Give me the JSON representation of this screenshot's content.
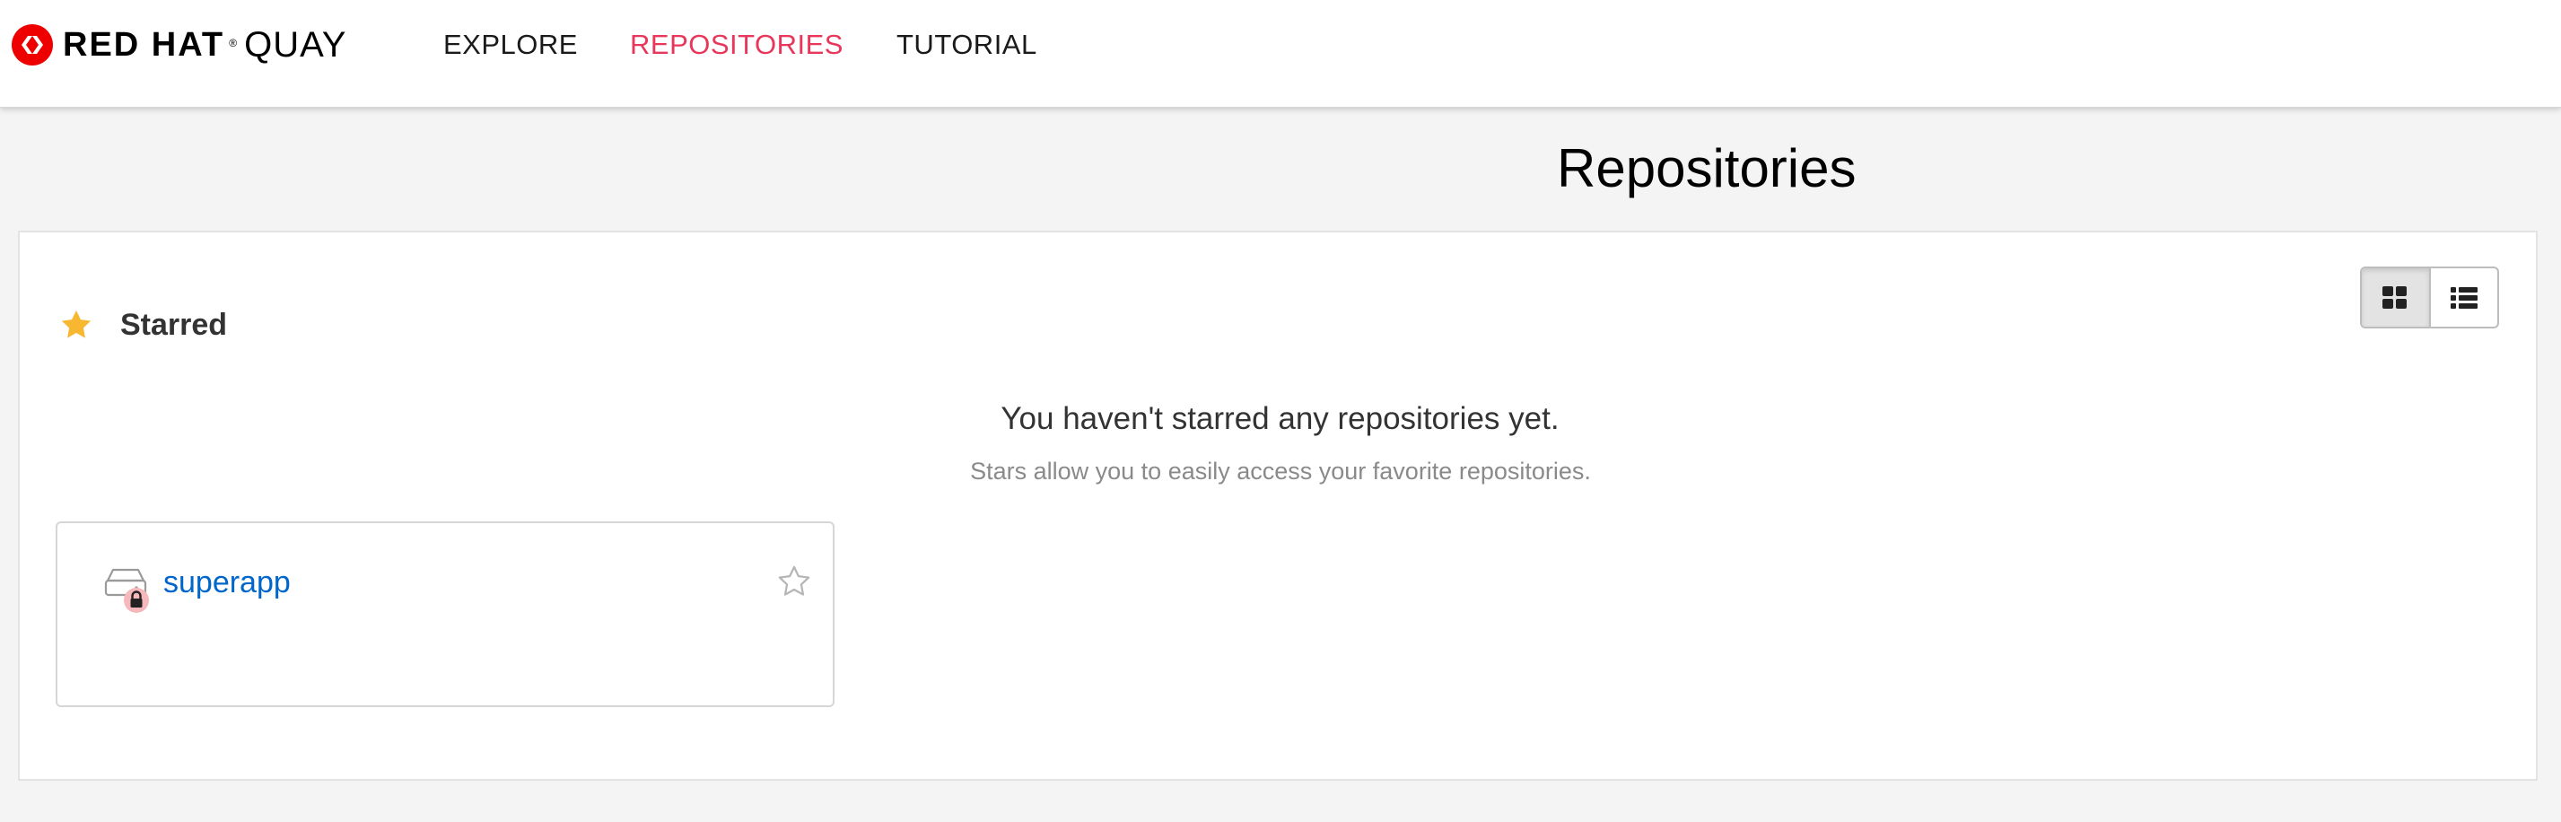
{
  "brand": {
    "name": "RED HAT",
    "registered_mark": "®",
    "product": "QUAY",
    "accent_color": "#ee0000"
  },
  "nav": {
    "items": [
      {
        "label": "EXPLORE",
        "active": false
      },
      {
        "label": "REPOSITORIES",
        "active": true
      },
      {
        "label": "TUTORIAL",
        "active": false
      }
    ],
    "active_color": "#e8375a"
  },
  "page": {
    "title": "Repositories"
  },
  "view_toggle": {
    "options": [
      {
        "icon": "grid-view-icon",
        "selected": true
      },
      {
        "icon": "list-view-icon",
        "selected": false
      }
    ]
  },
  "starred": {
    "icon": "star-filled-icon",
    "icon_color": "#f7b731",
    "title": "Starred",
    "empty_title": "You haven't starred any repositories yet.",
    "empty_subtitle": "Stars allow you to easily access your favorite repositories."
  },
  "repositories": [
    {
      "name": "superapp",
      "icon": "private-repository-icon",
      "private": true,
      "starred": false,
      "link_color": "#0066cc"
    }
  ]
}
